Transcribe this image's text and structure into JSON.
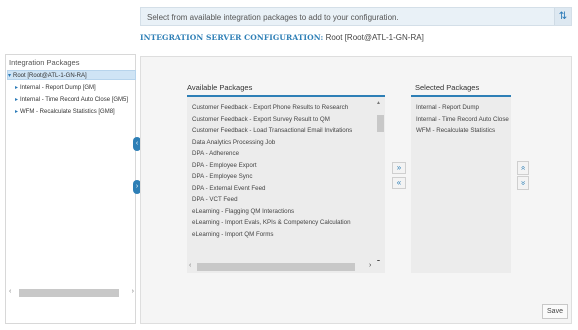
{
  "topbar": {
    "message": "Select from available integration packages to add to your configuration.",
    "sort_icon": "⇅"
  },
  "header": {
    "label": "INTEGRATION SERVER CONFIGURATION:",
    "value": "Root [Root@ATL-1-GN-RA]"
  },
  "tree": {
    "title": "Integration Packages",
    "root": "Root [Root@ATL-1-GN-RA]",
    "children": [
      "Internal - Report Dump [GM]",
      "Internal - Time Record Auto Close [GM5]",
      "WFM - Recalculate Statistics [GM8]"
    ]
  },
  "available": {
    "title": "Available Packages",
    "items": [
      "Customer Feedback - Export Phone Results to Research",
      "Customer Feedback - Export Survey Result to QM",
      "Customer Feedback - Load Transactional Email Invitations",
      "Data Analytics Processing Job",
      "DPA - Adherence",
      "DPA - Employee Export",
      "DPA - Employee Sync",
      "DPA - External Event Feed",
      "DPA - VCT Feed",
      "eLearning - Flagging QM Interactions",
      "eLearning - Import Evals, KPIs & Competency Calculation",
      "eLearning - Import QM Forms"
    ]
  },
  "selected": {
    "title": "Selected Packages",
    "items": [
      "Internal - Report Dump",
      "Internal - Time Record Auto Close",
      "WFM - Recalculate Statistics"
    ]
  },
  "buttons": {
    "add_all": "»",
    "remove_all": "«",
    "move_up": "«",
    "move_down": "»",
    "save": "Save"
  }
}
